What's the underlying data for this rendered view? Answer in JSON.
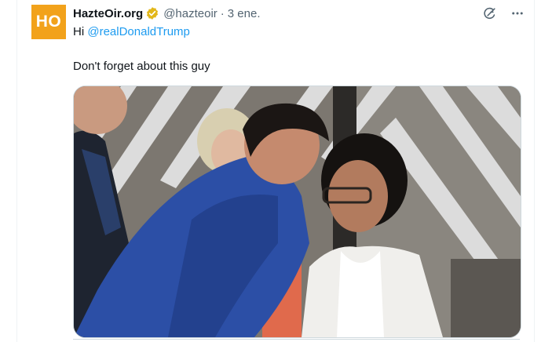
{
  "tweet": {
    "author_name": "HazteOir.org",
    "author_handle": "@hazteoir",
    "separator": "·",
    "date": "3 ene.",
    "avatar_text": "HO",
    "greeting": "Hi ",
    "mention": "@realDonaldTrump",
    "body": "Don't forget about this guy"
  },
  "icons": {
    "verified": "verified-badge-icon",
    "grok": "grok-icon",
    "more": "more-icon"
  },
  "colors": {
    "avatar_bg": "#f2a21b",
    "verified_gold": "#e2b719",
    "mention": "#1d9bf0",
    "secondary_text": "#536471"
  }
}
